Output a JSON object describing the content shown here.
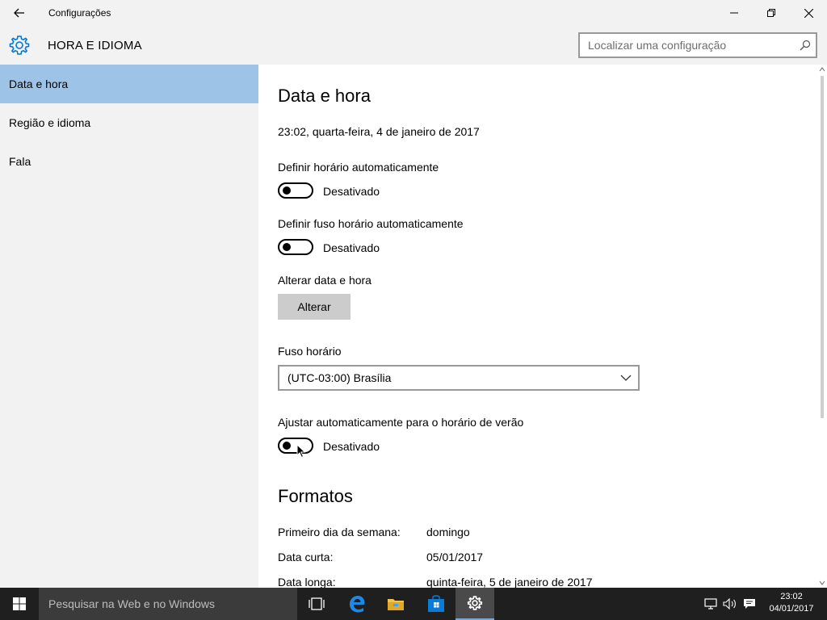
{
  "window": {
    "title": "Configurações",
    "header_title": "HORA E IDIOMA"
  },
  "search": {
    "placeholder": "Localizar uma configuração"
  },
  "sidebar": {
    "items": [
      {
        "label": "Data e hora",
        "active": true
      },
      {
        "label": "Região e idioma",
        "active": false
      },
      {
        "label": "Fala",
        "active": false
      }
    ]
  },
  "main": {
    "section_title": "Data e hora",
    "current_datetime": "23:02, quarta-feira, 4 de janeiro de 2017",
    "auto_time": {
      "label": "Definir horário automaticamente",
      "state": "Desativado"
    },
    "auto_timezone": {
      "label": "Definir fuso horário automaticamente",
      "state": "Desativado"
    },
    "change_datetime": {
      "label": "Alterar data e hora",
      "button": "Alterar"
    },
    "timezone": {
      "label": "Fuso horário",
      "value": "(UTC-03:00) Brasília"
    },
    "dst": {
      "label": "Ajustar automaticamente para o horário de verão",
      "state": "Desativado"
    },
    "formats": {
      "title": "Formatos",
      "rows": [
        {
          "label": "Primeiro dia da semana:",
          "value": "domingo"
        },
        {
          "label": "Data curta:",
          "value": "05/01/2017"
        },
        {
          "label": "Data longa:",
          "value": "quinta-feira, 5 de janeiro de 2017"
        }
      ]
    }
  },
  "taskbar": {
    "search_placeholder": "Pesquisar na Web e no Windows",
    "clock_time": "23:02",
    "clock_date": "04/01/2017",
    "icons": [
      "task-view-icon",
      "edge-icon",
      "file-explorer-icon",
      "store-icon",
      "settings-icon"
    ]
  },
  "colors": {
    "accent": "#0078d7",
    "sidebar_active": "#9dc4e6",
    "chrome_bg": "#f2f2f2",
    "taskbar_bg": "#1f1f1f"
  }
}
